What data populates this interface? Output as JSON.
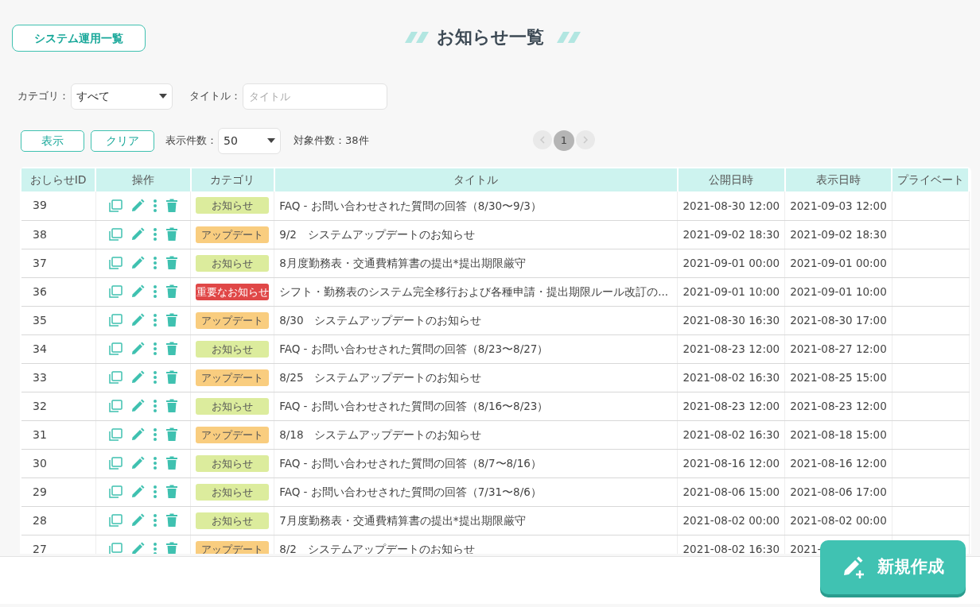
{
  "back_button": "システム運用一覧",
  "page_title": "お知らせ一覧",
  "filters": {
    "category_label": "カテゴリ：",
    "category_value": "すべて",
    "title_label": "タイトル：",
    "title_placeholder": "タイトル"
  },
  "actions": {
    "show_button": "表示",
    "clear_button": "クリア",
    "per_page_label": "表示件数：",
    "per_page_value": "50",
    "count_text": "対象件数：38件"
  },
  "pagination": {
    "pages": [
      {
        "label": "1",
        "selected": true
      }
    ]
  },
  "table": {
    "columns": [
      "おしらせID",
      "操作",
      "カテゴリ",
      "タイトル",
      "公開日時",
      "表示日時",
      "プライベート"
    ],
    "rows": [
      {
        "id": "39",
        "category": {
          "label": "お知らせ",
          "kind": "notice"
        },
        "title": "FAQ - お問い合わせされた質問の回答（8/30〜9/3）",
        "published": "2021-08-30 12:00",
        "displayed": "2021-09-03 12:00"
      },
      {
        "id": "38",
        "category": {
          "label": "アップデート",
          "kind": "update"
        },
        "title": "9/2　システムアップデートのお知らせ",
        "published": "2021-09-02 18:30",
        "displayed": "2021-09-02 18:30"
      },
      {
        "id": "37",
        "category": {
          "label": "お知らせ",
          "kind": "notice"
        },
        "title": "8月度勤務表・交通費精算書の提出*提出期限厳守",
        "published": "2021-09-01 00:00",
        "displayed": "2021-09-01 00:00"
      },
      {
        "id": "36",
        "category": {
          "label": "重要なお知らせ",
          "kind": "important"
        },
        "title": "シフト・勤務表のシステム完全移行および各種申請・提出期限ルール改訂の...",
        "published": "2021-09-01 10:00",
        "displayed": "2021-09-01 10:00"
      },
      {
        "id": "35",
        "category": {
          "label": "アップデート",
          "kind": "update"
        },
        "title": "8/30　システムアップデートのお知らせ",
        "published": "2021-08-30 16:30",
        "displayed": "2021-08-30 17:00"
      },
      {
        "id": "34",
        "category": {
          "label": "お知らせ",
          "kind": "notice"
        },
        "title": "FAQ - お問い合わせされた質問の回答（8/23〜8/27）",
        "published": "2021-08-23 12:00",
        "displayed": "2021-08-27 12:00"
      },
      {
        "id": "33",
        "category": {
          "label": "アップデート",
          "kind": "update"
        },
        "title": "8/25　システムアップデートのお知らせ",
        "published": "2021-08-02 16:30",
        "displayed": "2021-08-25 15:00"
      },
      {
        "id": "32",
        "category": {
          "label": "お知らせ",
          "kind": "notice"
        },
        "title": "FAQ - お問い合わせされた質問の回答（8/16〜8/23）",
        "published": "2021-08-23 12:00",
        "displayed": "2021-08-23 12:00"
      },
      {
        "id": "31",
        "category": {
          "label": "アップデート",
          "kind": "update"
        },
        "title": "8/18　システムアップデートのお知らせ",
        "published": "2021-08-02 16:30",
        "displayed": "2021-08-18 15:00"
      },
      {
        "id": "30",
        "category": {
          "label": "お知らせ",
          "kind": "notice"
        },
        "title": "FAQ - お問い合わせされた質問の回答（8/7〜8/16）",
        "published": "2021-08-16 12:00",
        "displayed": "2021-08-16 12:00"
      },
      {
        "id": "29",
        "category": {
          "label": "お知らせ",
          "kind": "notice"
        },
        "title": "FAQ - お問い合わせされた質問の回答（7/31〜8/6）",
        "published": "2021-08-06 15:00",
        "displayed": "2021-08-06 17:00"
      },
      {
        "id": "28",
        "category": {
          "label": "お知らせ",
          "kind": "notice"
        },
        "title": "7月度勤務表・交通費精算書の提出*提出期限厳守",
        "published": "2021-08-02 00:00",
        "displayed": "2021-08-02 00:00"
      },
      {
        "id": "27",
        "category": {
          "label": "アップデート",
          "kind": "update"
        },
        "title": "8/2　システムアップデートのお知らせ",
        "published": "2021-08-02 16:30",
        "displayed": "2021-"
      }
    ]
  },
  "new_button": "新規作成"
}
